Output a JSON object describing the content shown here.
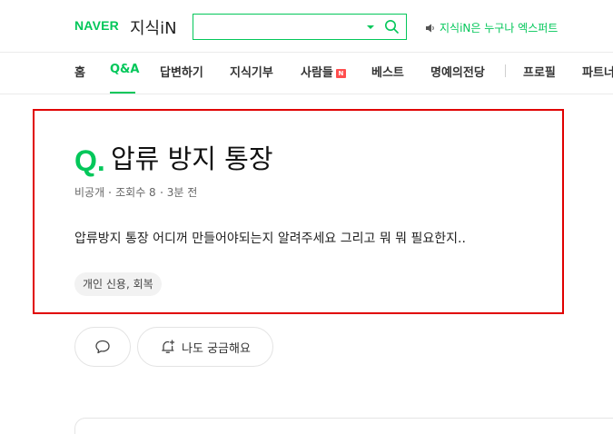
{
  "header": {
    "naver_logo": "NAVER",
    "service_logo": "지식iN",
    "search": {
      "value": "",
      "placeholder": ""
    },
    "notice_text": "지식iN은 누구나 엑스퍼트"
  },
  "nav": {
    "items": [
      {
        "label": "홈"
      },
      {
        "label": "Q&A"
      },
      {
        "label": "답변하기"
      },
      {
        "label": "지식기부"
      },
      {
        "label": "사람들",
        "badge": "N"
      },
      {
        "label": "베스트"
      },
      {
        "label": "명예의전당"
      },
      {
        "label": "프로필"
      },
      {
        "label": "파트너"
      }
    ],
    "active": "Q&A"
  },
  "question": {
    "q_mark": "Q.",
    "title": "압류 방지 통장",
    "author": "비공개",
    "views": "조회수 8",
    "time": "3분 전",
    "body": "압류방지 통장 어디꺼 만들어야되는지 알려주세요 그리고 뭐 뭐 필요한지..",
    "tag": "개인 신용, 회복"
  },
  "actions": {
    "curious_label": "나도 궁금해요"
  },
  "colors": {
    "brand": "#03c75a",
    "highlight": "#e00000"
  }
}
